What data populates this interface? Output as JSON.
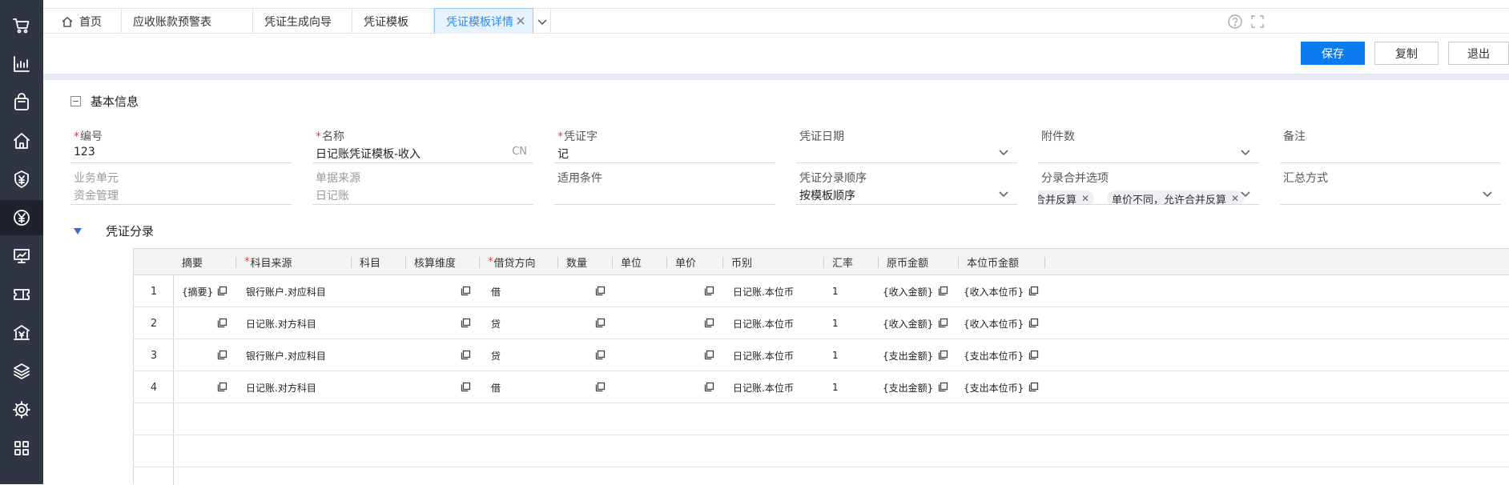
{
  "sidebar": {
    "icons": [
      "cart-icon",
      "chart-icon",
      "bag-icon",
      "home-icon",
      "money-shield-icon",
      "yen-icon",
      "presentation-icon",
      "ticket-icon",
      "bank-icon",
      "layers-icon",
      "gear-icon",
      "apps-icon"
    ],
    "active_index": 5
  },
  "tabs": [
    {
      "label": "首页",
      "icon": "home-icon"
    },
    {
      "label": "应收账款预警表"
    },
    {
      "label": "凭证生成向导"
    },
    {
      "label": "凭证模板"
    },
    {
      "label": "凭证模板详情",
      "active": true
    }
  ],
  "toolbar": {
    "save": "保存",
    "copy": "复制",
    "exit": "退出"
  },
  "basic": {
    "title": "基本信息",
    "fields": [
      {
        "label": "编号",
        "required": true,
        "value": "123"
      },
      {
        "label": "名称",
        "required": true,
        "value": "日记账凭证模板-收入",
        "suffix": "CN"
      },
      {
        "label": "凭证字",
        "required": true,
        "value": "记"
      },
      {
        "label": "凭证日期",
        "value": ""
      },
      {
        "label": "附件数",
        "value": ""
      },
      {
        "label": "备注",
        "value": ""
      },
      {
        "label": "业务单元",
        "value": "资金管理"
      },
      {
        "label": "单据来源",
        "value": "日记账"
      },
      {
        "label": "适用条件",
        "value": ""
      },
      {
        "label": "凭证分录顺序",
        "value": "按模板顺序"
      },
      {
        "label": "分录合并选项",
        "chips": [
          "合并反算",
          "单价不同，允许合并反算"
        ]
      },
      {
        "label": "汇总方式",
        "value": ""
      }
    ]
  },
  "entries": {
    "title": "凭证分录",
    "columns": [
      {
        "label": "摘要"
      },
      {
        "label": "科目来源",
        "required": true
      },
      {
        "label": "科目"
      },
      {
        "label": "核算维度"
      },
      {
        "label": "借贷方向",
        "required": true
      },
      {
        "label": "数量"
      },
      {
        "label": "单位"
      },
      {
        "label": "单价"
      },
      {
        "label": "币别"
      },
      {
        "label": "汇率"
      },
      {
        "label": "原币金额"
      },
      {
        "label": "本位币金额"
      }
    ],
    "rows": [
      {
        "no": "1",
        "summary": "{摘要}",
        "source": "银行账户.对应科目",
        "dir": "借",
        "currency": "日记账.本位币",
        "rate": "1",
        "orig": "{收入金额}",
        "local": "{收入本位币}"
      },
      {
        "no": "2",
        "summary": "",
        "source": "日记账.对方科目",
        "dir": "贷",
        "currency": "日记账.本位币",
        "rate": "1",
        "orig": "{收入金额}",
        "local": "{收入本位币}"
      },
      {
        "no": "3",
        "summary": "",
        "source": "银行账户.对应科目",
        "dir": "贷",
        "currency": "日记账.本位币",
        "rate": "1",
        "orig": "{支出金额}",
        "local": "{支出本位币}"
      },
      {
        "no": "4",
        "summary": "",
        "source": "日记账.对方科目",
        "dir": "借",
        "currency": "日记账.本位币",
        "rate": "1",
        "orig": "{支出金额}",
        "local": "{支出本位币}"
      }
    ]
  }
}
